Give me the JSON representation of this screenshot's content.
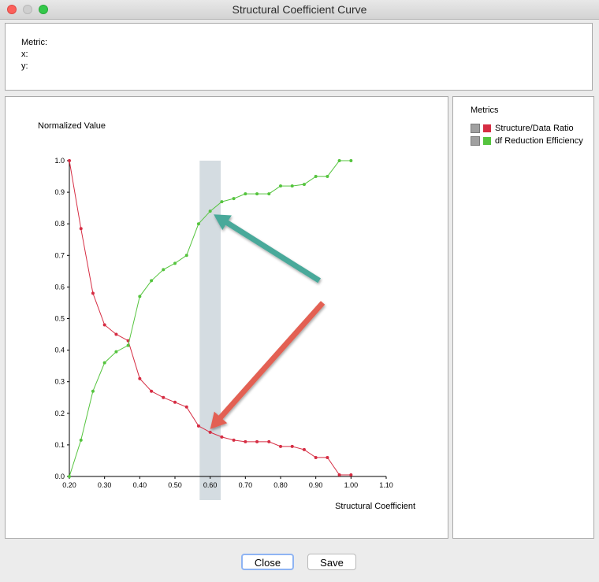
{
  "window": {
    "title": "Structural Coefficient Curve"
  },
  "info": {
    "metric_label": "Metric:",
    "x_label": "x:",
    "y_label": "y:"
  },
  "legend": {
    "title": "Metrics",
    "items": [
      {
        "label": "Structure/Data Ratio",
        "color": "#d62d43"
      },
      {
        "label": "df Reduction Efficiency",
        "color": "#55c43e"
      }
    ]
  },
  "buttons": {
    "close": "Close",
    "save": "Save"
  },
  "chart_data": {
    "type": "line",
    "ylabel": "Normalized Value",
    "xlabel": "Structural Coefficient",
    "xlim": [
      0.2,
      1.1
    ],
    "ylim": [
      0.0,
      1.0
    ],
    "x_ticks": [
      "0.20",
      "0.30",
      "0.40",
      "0.50",
      "0.60",
      "0.70",
      "0.80",
      "0.90",
      "1.00",
      "1.10"
    ],
    "y_ticks": [
      "0.0",
      "0.1",
      "0.2",
      "0.3",
      "0.4",
      "0.5",
      "0.6",
      "0.7",
      "0.8",
      "0.9",
      "1.0"
    ],
    "highlight_band": {
      "x_from": 0.57,
      "x_to": 0.63,
      "color": "#9fb2bd"
    },
    "series": [
      {
        "name": "Structure/Data Ratio",
        "color": "#d62d43",
        "x": [
          0.2,
          0.233,
          0.267,
          0.3,
          0.333,
          0.367,
          0.4,
          0.433,
          0.467,
          0.5,
          0.533,
          0.567,
          0.6,
          0.633,
          0.667,
          0.7,
          0.733,
          0.767,
          0.8,
          0.833,
          0.867,
          0.9,
          0.933,
          0.967,
          1.0
        ],
        "y": [
          1.0,
          0.785,
          0.58,
          0.48,
          0.45,
          0.43,
          0.31,
          0.27,
          0.25,
          0.235,
          0.22,
          0.16,
          0.14,
          0.125,
          0.115,
          0.11,
          0.11,
          0.11,
          0.095,
          0.095,
          0.085,
          0.06,
          0.06,
          0.005,
          0.005
        ]
      },
      {
        "name": "df Reduction Efficiency",
        "color": "#55c43e",
        "x": [
          0.2,
          0.233,
          0.267,
          0.3,
          0.333,
          0.367,
          0.4,
          0.433,
          0.467,
          0.5,
          0.533,
          0.567,
          0.6,
          0.633,
          0.667,
          0.7,
          0.733,
          0.767,
          0.8,
          0.833,
          0.867,
          0.9,
          0.933,
          0.967,
          1.0
        ],
        "y": [
          0.0,
          0.115,
          0.27,
          0.36,
          0.395,
          0.415,
          0.57,
          0.62,
          0.655,
          0.675,
          0.7,
          0.8,
          0.84,
          0.87,
          0.88,
          0.895,
          0.895,
          0.895,
          0.92,
          0.92,
          0.925,
          0.95,
          0.95,
          1.0,
          1.0
        ]
      }
    ],
    "annotations": [
      {
        "type": "arrow",
        "color": "#4aa99a",
        "from": [
          0.91,
          0.62
        ],
        "to": [
          0.61,
          0.83
        ]
      },
      {
        "type": "arrow",
        "color": "#e36052",
        "from": [
          0.92,
          0.55
        ],
        "to": [
          0.6,
          0.15
        ]
      }
    ]
  }
}
